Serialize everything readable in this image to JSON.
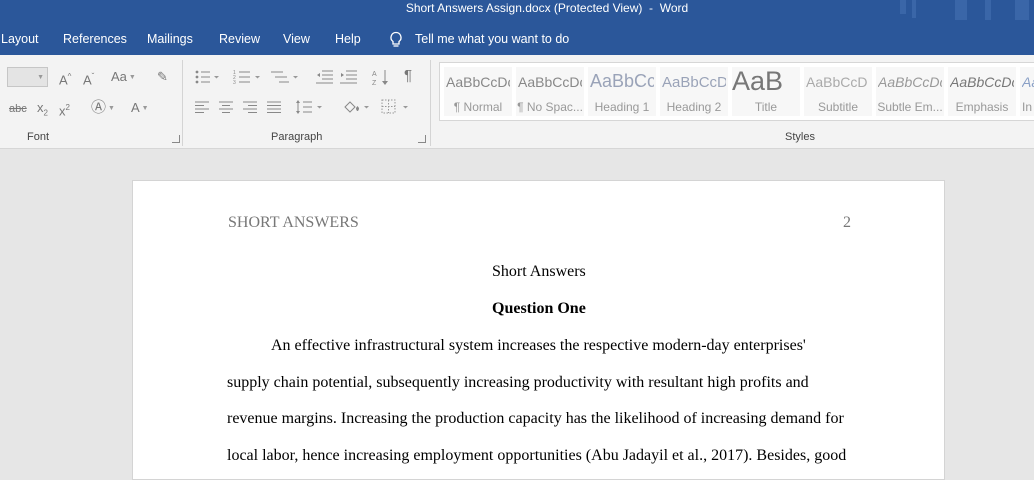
{
  "titlebar": {
    "title": "Short Answers Assign.docx (Protected View)  -  Word"
  },
  "tabs": [
    "Layout",
    "References",
    "Mailings",
    "Review",
    "View",
    "Help"
  ],
  "tellme": "Tell me what you want to do",
  "ribbon": {
    "font_icons_row1": [
      "A^",
      "Aˇ",
      "Aa",
      "✎"
    ],
    "font_icons_row2": [
      "abc",
      "x₂",
      "x²",
      "A",
      "A"
    ],
    "groups": {
      "font": "Font",
      "paragraph": "Paragraph",
      "styles": "Styles"
    },
    "styles": [
      {
        "sample": "AaBbCcDc",
        "name": "¶ Normal"
      },
      {
        "sample": "AaBbCcDc",
        "name": "¶ No Spac..."
      },
      {
        "sample": "AaBbCc",
        "name": "Heading 1"
      },
      {
        "sample": "AaBbCcD",
        "name": "Heading 2"
      },
      {
        "sample": "AaB",
        "name": "Title"
      },
      {
        "sample": "AaBbCcD",
        "name": "Subtitle"
      },
      {
        "sample": "AaBbCcDc",
        "name": "Subtle Em..."
      },
      {
        "sample": "AaBbCcDc",
        "name": "Emphasis"
      },
      {
        "sample": "AaBbCcDc",
        "name": "In"
      }
    ]
  },
  "document": {
    "running_head": "SHORT ANSWERS",
    "page_number": "2",
    "title": "Short Answers",
    "heading": "Question One",
    "lines": [
      "An effective infrastructural system increases the respective modern-day enterprises'",
      "supply chain potential, subsequently increasing productivity with resultant high profits and",
      "revenue margins. Increasing the production capacity has the likelihood of increasing demand for",
      "local labor, hence increasing employment opportunities (Abu Jadayil et al., 2017). Besides, good"
    ]
  }
}
